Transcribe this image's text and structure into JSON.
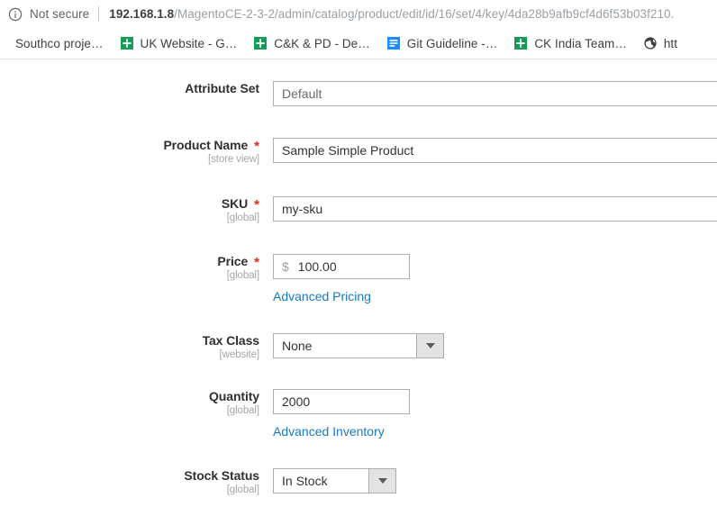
{
  "browser": {
    "security_icon": "info-circle-icon",
    "security_label": "Not secure",
    "url_host": "192.168.1.8",
    "url_path": "/MagentoCE-2-3-2/admin/catalog/product/edit/id/16/set/4/key/4da28b9afb9cf4d6f53b03f210.",
    "bookmarks": [
      {
        "label": "Southco proje…",
        "icon": "none"
      },
      {
        "label": "UK Website - G…",
        "icon": "google-sheets-icon"
      },
      {
        "label": "C&K & PD - De…",
        "icon": "google-sheets-icon"
      },
      {
        "label": "Git Guideline -…",
        "icon": "google-docs-icon"
      },
      {
        "label": "CK India Team…",
        "icon": "google-sheets-icon"
      },
      {
        "label": "htt",
        "icon": "globe-icon"
      }
    ]
  },
  "form": {
    "attribute_set": {
      "label": "Attribute Set",
      "value": "Default",
      "required": false,
      "scope": ""
    },
    "product_name": {
      "label": "Product Name",
      "value": "Sample Simple Product",
      "required": true,
      "required_mark": "*",
      "scope": "[store view]"
    },
    "sku": {
      "label": "SKU",
      "value": "my-sku",
      "required": true,
      "required_mark": "*",
      "scope": "[global]"
    },
    "price": {
      "label": "Price",
      "currency_symbol": "$",
      "value": "100.00",
      "required": true,
      "required_mark": "*",
      "scope": "[global]",
      "advanced_link": "Advanced Pricing"
    },
    "tax_class": {
      "label": "Tax Class",
      "value": "None",
      "required": false,
      "scope": "[website]"
    },
    "quantity": {
      "label": "Quantity",
      "value": "2000",
      "required": false,
      "scope": "[global]",
      "advanced_link": "Advanced Inventory"
    },
    "stock_status": {
      "label": "Stock Status",
      "value": "In Stock",
      "required": false,
      "scope": "[global]"
    }
  },
  "colors": {
    "link": "#1979c3",
    "required": "#e22626",
    "label": "#303030",
    "scope_note": "#a6a6a6",
    "input_border": "#adadad",
    "sheets_green": "#0f9d58",
    "docs_blue": "#1a8cff"
  }
}
